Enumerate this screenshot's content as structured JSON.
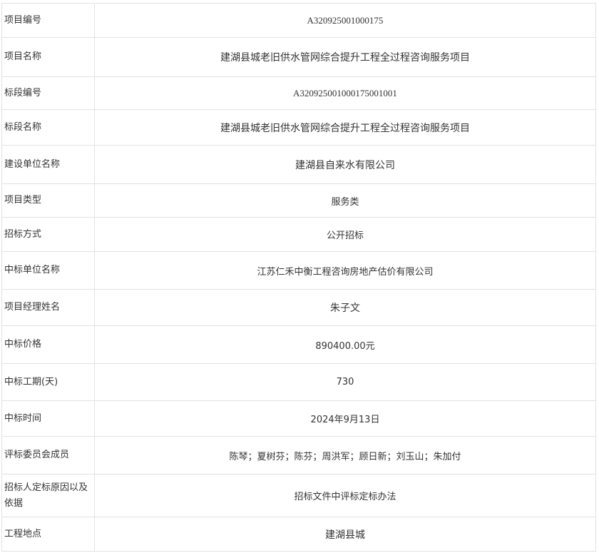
{
  "rows": [
    {
      "label": "项目编号",
      "value": "A320925001000175"
    },
    {
      "label": "项目名称",
      "value": "建湖县城老旧供水管网综合提升工程全过程咨询服务项目"
    },
    {
      "label": "标段编号",
      "value": "A320925001000175001001"
    },
    {
      "label": "标段名称",
      "value": "建湖县城老旧供水管网综合提升工程全过程咨询服务项目"
    },
    {
      "label": "建设单位名称",
      "value": "建湖县自来水有限公司"
    },
    {
      "label": "项目类型",
      "value": "服务类"
    },
    {
      "label": "招标方式",
      "value": "公开招标"
    },
    {
      "label": "中标单位名称",
      "value": "江苏仁禾中衡工程咨询房地产估价有限公司"
    },
    {
      "label": "项目经理姓名",
      "value": "朱子文"
    },
    {
      "label": "中标价格",
      "value": "890400.00元"
    },
    {
      "label": "中标工期(天)",
      "value": "730"
    },
    {
      "label": "中标时间",
      "value": "2024年9月13日"
    },
    {
      "label": "评标委员会成员",
      "value": "陈琴；夏树芬；陈芬；周洪军；顾日新；刘玉山；朱加付"
    },
    {
      "label": "招标人定标原因以及依据",
      "value": "招标文件中评标定标办法"
    },
    {
      "label": "工程地点",
      "value": "建湖县城"
    }
  ]
}
